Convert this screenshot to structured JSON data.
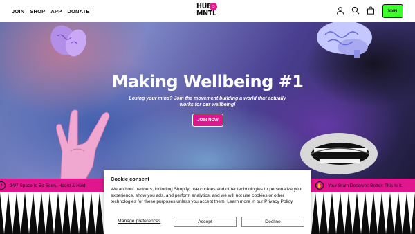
{
  "header": {
    "nav": [
      "JOIN",
      "SHOP",
      "APP",
      "DONATE"
    ],
    "logo_line1": "HUB",
    "logo_line2": "MNTL",
    "logo_badge": "☺",
    "join_label": "JOIN!",
    "icons": [
      "account-icon",
      "search-icon",
      "cart-icon"
    ]
  },
  "hero": {
    "title": "Making Wellbeing #1",
    "subtitle": "Losing your mind? Join the movement building a world that actually works for our wellbeing!",
    "cta": "JOIN NOW"
  },
  "ticker": {
    "left": "24/7 Space to Be Seen, Heard & Held",
    "right": "Your Brain Deserves Better: This Is It."
  },
  "cookie": {
    "title": "Cookie consent",
    "text": "We and our partners, including Shopify, use cookies and other technologies to personalize your experience, show you ads, and perform analytics, and we will not use cookies or other technologies for these purposes unless you accept them. Learn more in our ",
    "link": "Privacy Policy",
    "manage": "Manage preferences",
    "accept": "Accept",
    "decline": "Decline"
  },
  "colors": {
    "pink": "#e0168f",
    "green": "#3cff2b",
    "dark": "#0b0b0b"
  }
}
